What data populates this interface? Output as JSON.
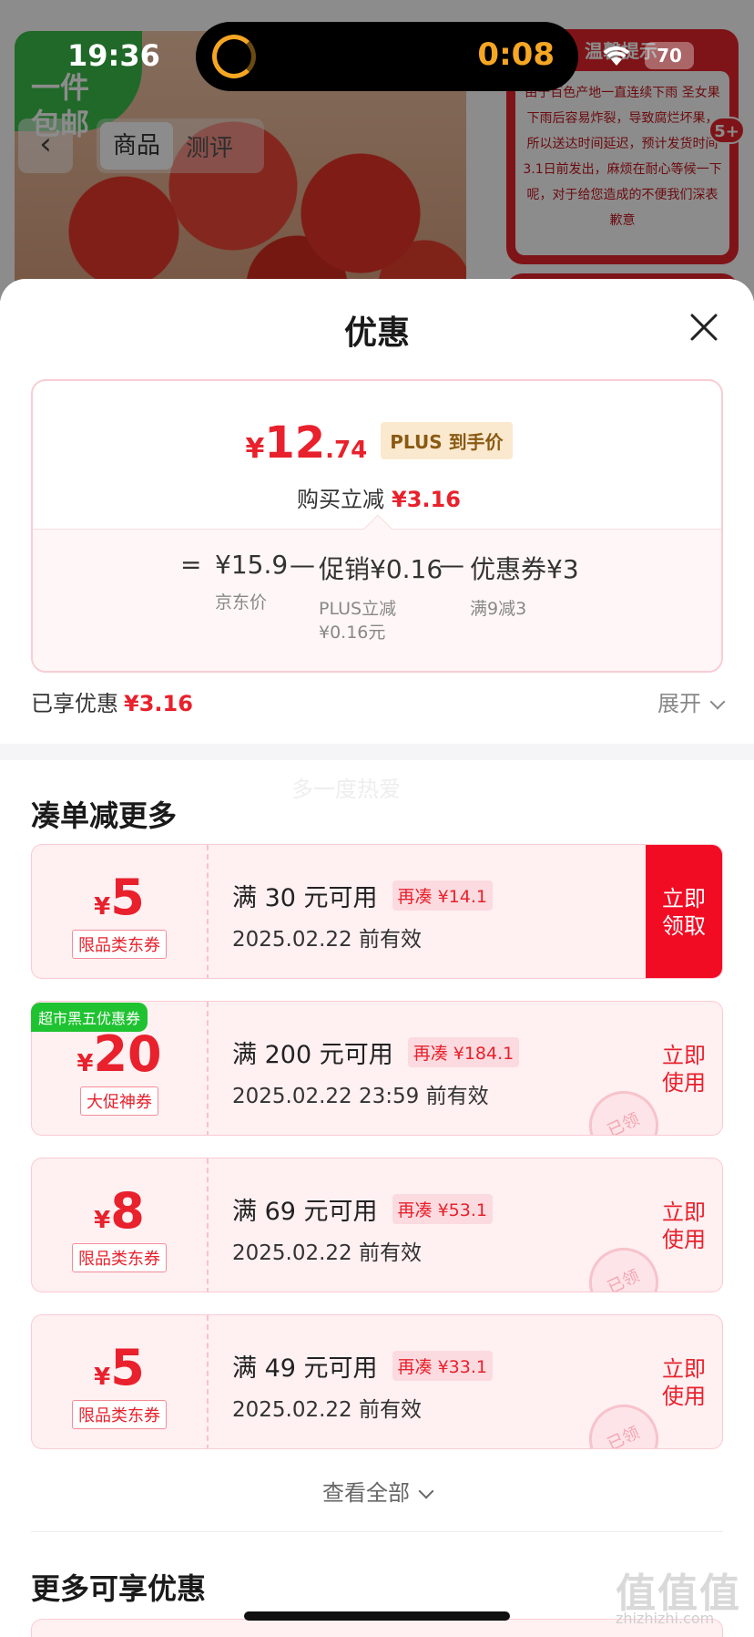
{
  "status": {
    "time": "19:36",
    "timer": "0:08",
    "battery": "70"
  },
  "background": {
    "badge": "一件\n包邮",
    "tabs": [
      "商品",
      "测评"
    ],
    "notice_title": "温馨提示",
    "notice_text": "由于百色产地一直连续下雨 圣女果下雨后容易炸裂，导致腐烂坏果，所以送达时间延迟，预计发货时间3.1日前发出，麻烦在耐心等候一下呢，对于给您造成的不便我们深表歉意",
    "cart_count": "5+"
  },
  "sheet": {
    "title": "优惠",
    "price": {
      "yen": "¥",
      "int": "12",
      "dec": ".74",
      "plus_tag": "PLUS 到手价"
    },
    "buy_reduce": {
      "label": "购买立减",
      "value": "¥3.16"
    },
    "breakdown": {
      "eq": "=",
      "minus": "—",
      "jd_price": "¥15.9",
      "jd_label": "京东价",
      "promo": "促销¥0.16",
      "promo_label": "PLUS立减\n¥0.16元",
      "coupon": "优惠券¥3",
      "coupon_label": "满9减3"
    },
    "enjoyed": {
      "label": "已享优惠",
      "value": "¥3.16",
      "expand": "展开"
    },
    "watermark": "多一度热爱",
    "section_more": "凑单减更多",
    "coupons": [
      {
        "yen": "¥",
        "amount": "5",
        "type": "限品类东券",
        "cond": "满 30 元可用",
        "need": "再凑 ¥14.1",
        "date": "2025.02.22 前有效",
        "action": "立即\n领取",
        "tag": ""
      },
      {
        "yen": "¥",
        "amount": "20",
        "type": "大促神券",
        "cond": "满 200 元可用",
        "need": "再凑 ¥184.1",
        "date": "2025.02.22 23:59 前有效",
        "action": "立即\n使用",
        "tag": "超市黑五优惠券"
      },
      {
        "yen": "¥",
        "amount": "8",
        "type": "限品类东券",
        "cond": "满 69 元可用",
        "need": "再凑 ¥53.1",
        "date": "2025.02.22 前有效",
        "action": "立即\n使用",
        "tag": ""
      },
      {
        "yen": "¥",
        "amount": "5",
        "type": "限品类东券",
        "cond": "满 49 元可用",
        "need": "再凑 ¥33.1",
        "date": "2025.02.22 前有效",
        "action": "立即\n使用",
        "tag": ""
      }
    ],
    "claimed_stamp": "已领",
    "see_all": "查看全部",
    "section_more2": "更多可享优惠"
  },
  "logo": {
    "text": "值值值",
    "url": "zhizhizhi.com"
  }
}
